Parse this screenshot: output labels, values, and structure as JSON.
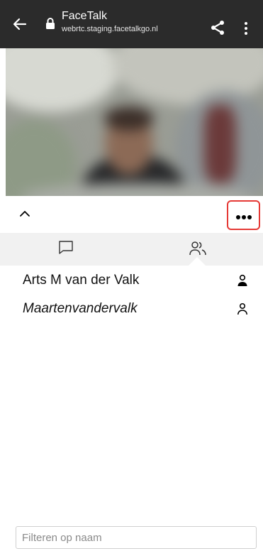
{
  "browser": {
    "title": "FaceTalk",
    "url": "webrtc.staging.facetalkgo.nl",
    "icons": {
      "back": "arrow-left-icon",
      "secure": "lock-icon",
      "share": "share-icon",
      "menu": "more-vertical-icon"
    }
  },
  "call": {
    "toolbar": {
      "collapse_icon": "chevron-up-icon",
      "more_icon": "more-horizontal-icon",
      "highlight_color": "#e53935"
    },
    "tabs": [
      {
        "id": "chat",
        "icon": "chat-bubble-icon",
        "selected": false
      },
      {
        "id": "participants",
        "icon": "users-icon",
        "selected": true
      }
    ],
    "participants": [
      {
        "name": "Arts M van der Valk",
        "icon": "person-filled-icon",
        "italic": false
      },
      {
        "name": "Maartenvandervalk",
        "icon": "person-outline-icon",
        "italic": true
      }
    ],
    "filter": {
      "placeholder": "Filteren op naam",
      "value": ""
    }
  }
}
